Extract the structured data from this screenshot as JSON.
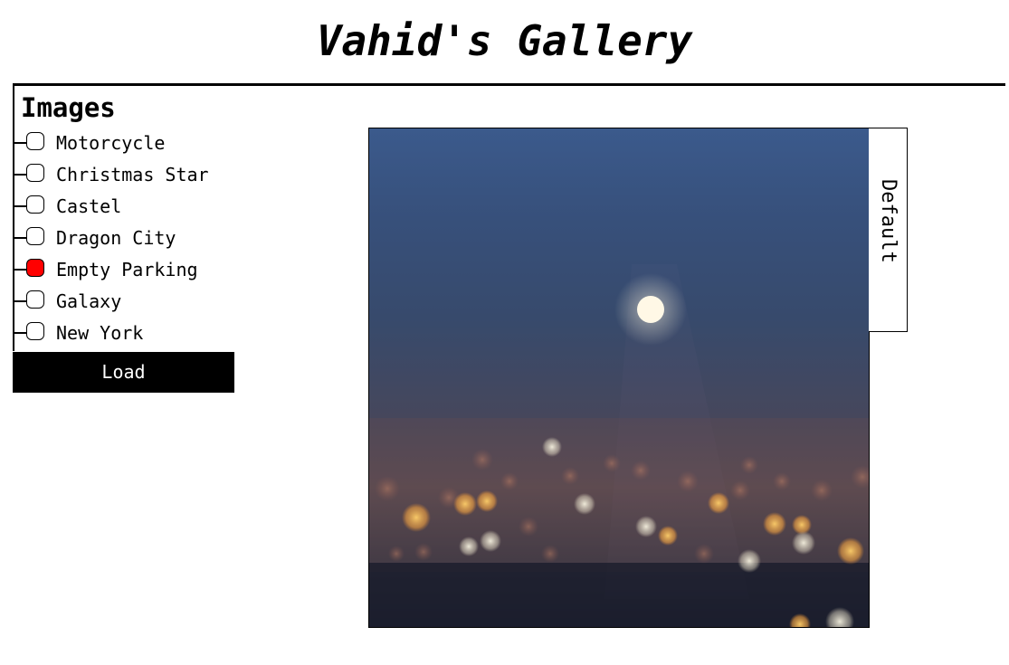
{
  "app": {
    "title": "Vahid's Gallery"
  },
  "sidebar": {
    "heading": "Images",
    "items": [
      {
        "label": "Motorcycle",
        "checked": false
      },
      {
        "label": "Christmas Star",
        "checked": false
      },
      {
        "label": "Castel",
        "checked": false
      },
      {
        "label": "Dragon City",
        "checked": false
      },
      {
        "label": "Empty Parking",
        "checked": true
      },
      {
        "label": "Galaxy",
        "checked": false
      },
      {
        "label": "New York",
        "checked": false
      }
    ],
    "load_label": "Load",
    "checked_color": "#ff0000"
  },
  "viewer": {
    "filter_tab_label": "Default"
  }
}
